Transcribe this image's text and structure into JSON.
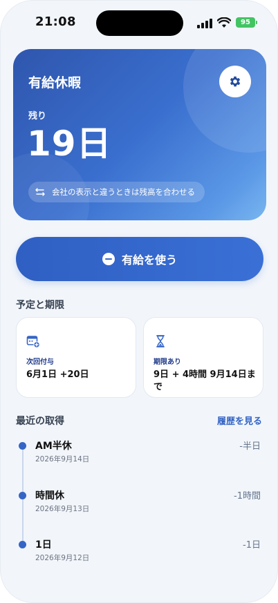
{
  "status": {
    "time": "21:08",
    "battery": "95"
  },
  "hero": {
    "title": "有給休暇",
    "remaining_label": "残り",
    "remaining_value": "19日",
    "adjust_label": "会社の表示と違うときは残高を合わせる"
  },
  "use_button": {
    "label": "有給を使う"
  },
  "deadline": {
    "title": "予定と期限",
    "cards": [
      {
        "icon": "calendar-plus-icon",
        "sub": "次回付与",
        "main": "6月1日  +20日"
      },
      {
        "icon": "hourglass-icon",
        "sub": "期限あり",
        "main": "9日 + 4時間  9月14日まで"
      }
    ]
  },
  "recent": {
    "title": "最近の取得",
    "history_link": "履歴を見る",
    "items": [
      {
        "type": "AM半休",
        "date": "2026年9月14日",
        "amount": "-半日"
      },
      {
        "type": "時間休",
        "date": "2026年9月13日",
        "amount": "-1時間"
      },
      {
        "type": "1日",
        "date": "2026年9月12日",
        "amount": "-1日"
      }
    ]
  },
  "colors": {
    "accent": "#3565c6",
    "background": "#f2f6fb",
    "battery": "#43c463"
  }
}
